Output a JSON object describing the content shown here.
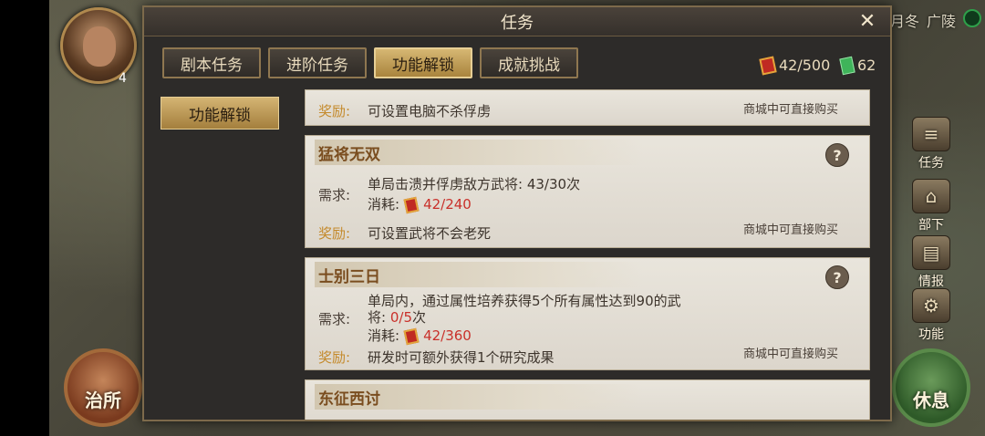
{
  "map": {
    "labels": [
      "月冬",
      "广陵"
    ]
  },
  "player": {
    "level": "4"
  },
  "buttons": {
    "zhisuo": "治所",
    "xiuxi": "休息"
  },
  "side_menu": [
    {
      "label": "任务",
      "icon": "scroll-icon"
    },
    {
      "label": "部下",
      "icon": "gate-icon"
    },
    {
      "label": "情报",
      "icon": "book-icon"
    },
    {
      "label": "功能",
      "icon": "gear-icon"
    }
  ],
  "modal": {
    "title": "任务",
    "close": "✕",
    "tabs": [
      "剧本任务",
      "进阶任务",
      "功能解锁",
      "成就挑战"
    ],
    "active_tab": "功能解锁",
    "resources": {
      "token": "42/500",
      "gem": "62"
    },
    "left_button": "功能解锁",
    "cards": [
      {
        "reward_label": "奖励:",
        "reward_text": "可设置电脑不杀俘虏",
        "shop_note": "商城中可直接购买"
      },
      {
        "title": "猛将无双",
        "help": "?",
        "req_label": "需求:",
        "req_line1_prefix": "单局击溃并俘虏敌方武将:",
        "req_line1_progress": "43/30",
        "req_line1_suffix": "次",
        "consume_label": "消耗:",
        "consume_value": "42/240",
        "reward_label": "奖励:",
        "reward_text": "可设置武将不会老死",
        "shop_note": "商城中可直接购买"
      },
      {
        "title": "士别三日",
        "help": "?",
        "req_label": "需求:",
        "req_line1": "单局内，通过属性培养获得5个所有属性达到90的武",
        "req_line2_prefix": "将:",
        "req_line2_progress": "0/5",
        "req_line2_suffix": "次",
        "consume_label": "消耗:",
        "consume_value": "42/360",
        "reward_label": "奖励:",
        "reward_text": "研发时可额外获得1个研究成果",
        "shop_note": "商城中可直接购买"
      },
      {
        "title": "东征西讨"
      }
    ]
  }
}
